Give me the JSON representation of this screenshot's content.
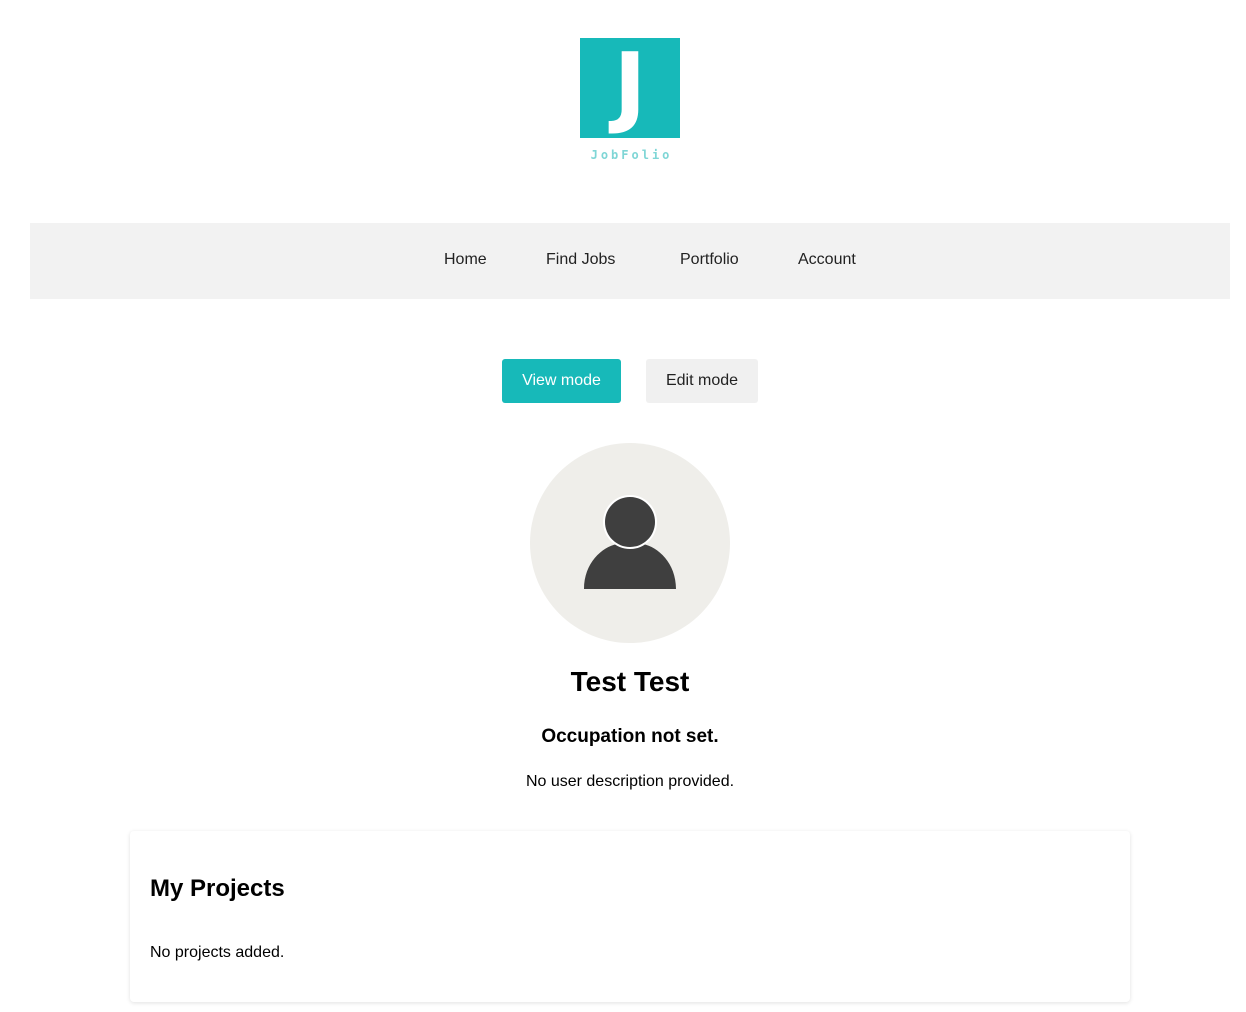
{
  "brand": {
    "logo_letter": "J",
    "logo_word": "JobFolio",
    "accent_color": "#17b9b9"
  },
  "nav": {
    "items": [
      {
        "label": "Home"
      },
      {
        "label": "Find Jobs"
      },
      {
        "label": "Portfolio"
      },
      {
        "label": "Account"
      }
    ]
  },
  "modes": {
    "view_label": "View mode",
    "edit_label": "Edit mode",
    "active": "view"
  },
  "profile": {
    "avatar_icon": "user-silhouette-icon",
    "name": "Test Test",
    "occupation": "Occupation not set.",
    "description": "No user description provided."
  },
  "projects": {
    "title": "My Projects",
    "empty_text": "No projects added."
  }
}
